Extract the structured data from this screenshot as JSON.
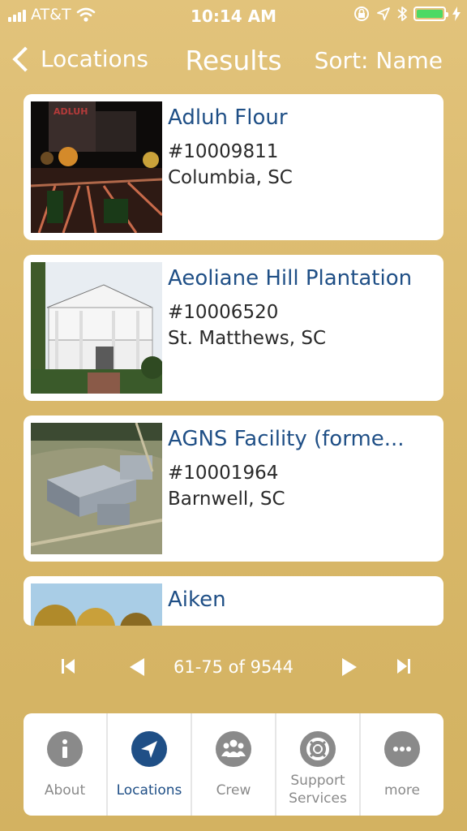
{
  "status_bar": {
    "carrier": "AT&T",
    "time": "10:14 AM",
    "icons": [
      "signal-icon",
      "wifi-icon",
      "orientation-lock-icon",
      "location-arrow-icon",
      "bluetooth-icon",
      "battery-icon",
      "charging-icon"
    ],
    "battery_color": "#4cd964"
  },
  "nav": {
    "back_label": "Locations",
    "title": "Results",
    "sort_label": "Sort: Name"
  },
  "results": [
    {
      "name": "Adluh Flour",
      "id": "#10009811",
      "city": "Columbia, SC"
    },
    {
      "name": "Aeoliane Hill Plantation",
      "id": "#10006520",
      "city": "St. Matthews, SC"
    },
    {
      "name": "AGNS Facility (forme...",
      "id": "#10001964",
      "city": "Barnwell, SC"
    },
    {
      "name": "Aiken"
    }
  ],
  "pagination": {
    "range_text": "61-75 of 9544",
    "icons": [
      "first-page-icon",
      "previous-page-icon",
      "next-page-icon",
      "last-page-icon"
    ]
  },
  "tabs": [
    {
      "label": "About",
      "icon": "info-icon"
    },
    {
      "label": "Locations",
      "icon": "location-arrow-icon",
      "active": true
    },
    {
      "label": "Crew",
      "icon": "group-icon"
    },
    {
      "label": "Support Services",
      "icon": "lifebuoy-icon"
    },
    {
      "label": "more",
      "icon": "more-icon"
    }
  ],
  "colors": {
    "background": "#dbba6b",
    "accent": "#1f4f86",
    "inactive": "#8a8a8a"
  }
}
